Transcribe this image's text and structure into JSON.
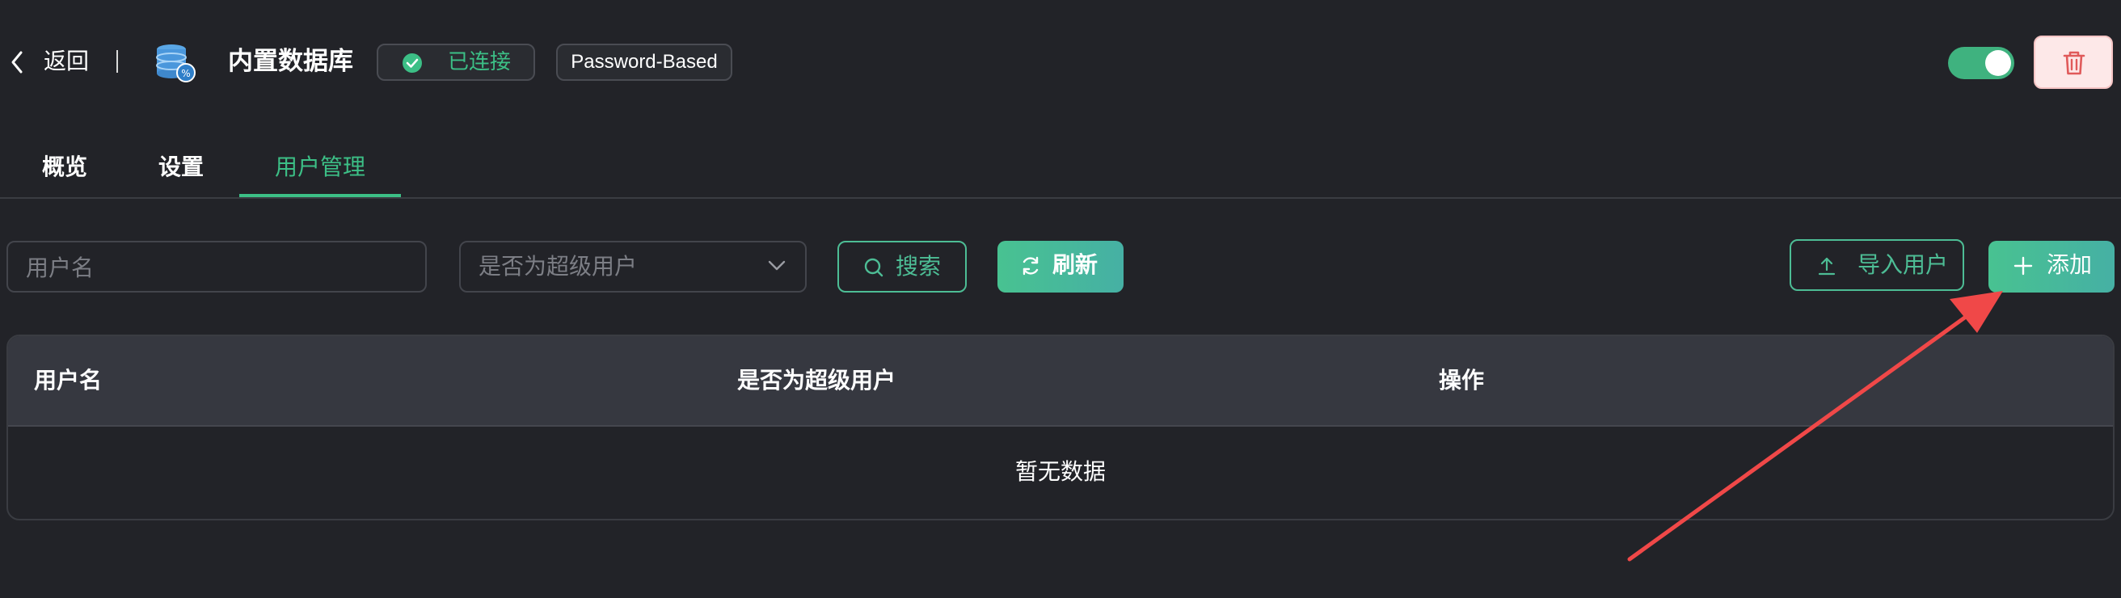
{
  "header": {
    "back_label": "返回",
    "db_name": "内置数据库",
    "status": "已连接",
    "auth_type": "Password-Based",
    "toggle_on": true
  },
  "tabs": [
    {
      "label": "概览",
      "active": false
    },
    {
      "label": "设置",
      "active": false
    },
    {
      "label": "用户管理",
      "active": true
    }
  ],
  "filters": {
    "username_placeholder": "用户名",
    "superuser_placeholder": "是否为超级用户",
    "search_label": "搜索",
    "refresh_label": "刷新",
    "import_label": "导入用户",
    "add_label": "添加"
  },
  "table": {
    "columns": [
      "用户名",
      "是否为超级用户",
      "操作"
    ],
    "rows": [],
    "empty_text": "暂无数据"
  },
  "colors": {
    "accent": "#3cbf86",
    "background": "#222328",
    "annotation_arrow": "#f04848",
    "danger_bg": "#fde8e8"
  }
}
